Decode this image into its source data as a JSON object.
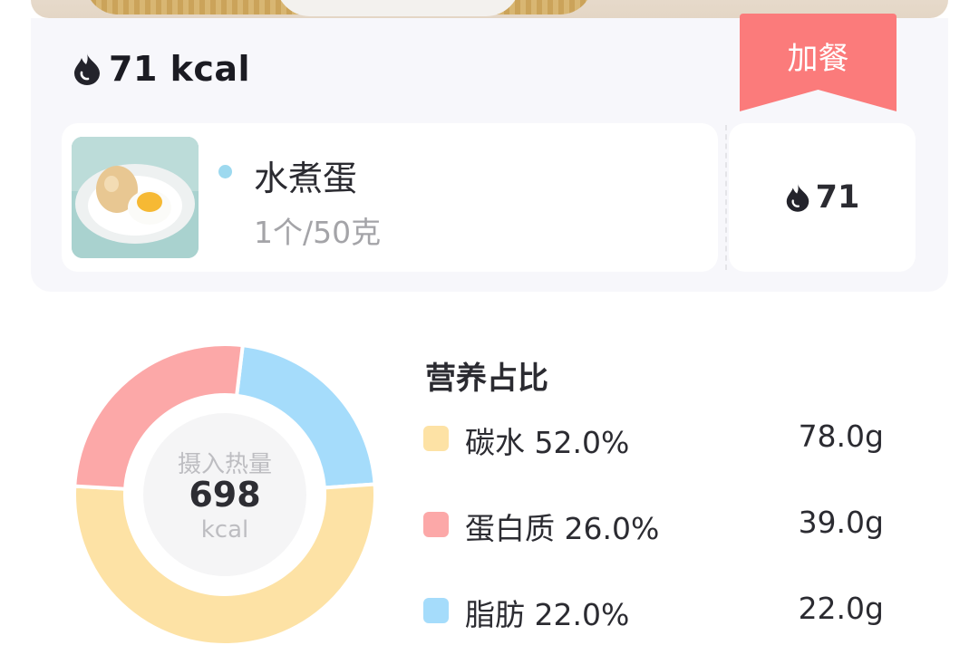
{
  "meal": {
    "total_kcal": "71 kcal",
    "tag_label": "加餐",
    "items": [
      {
        "name": "水煮蛋",
        "portion": "1个/50克",
        "kcal": "71"
      }
    ]
  },
  "summary": {
    "center_label": "摄入热量",
    "center_value": "698",
    "center_unit": "kcal",
    "title": "营养占比",
    "nutrients": [
      {
        "name": "碳水",
        "percent": "52.0%",
        "amount": "78.0g",
        "color": "#fde2a5"
      },
      {
        "name": "蛋白质",
        "percent": "26.0%",
        "amount": "39.0g",
        "color": "#fca8a8"
      },
      {
        "name": "脂肪",
        "percent": "22.0%",
        "amount": "22.0g",
        "color": "#a5dcfb"
      }
    ]
  },
  "colors": {
    "tag": "#fb7b7b",
    "flame": "#23232b"
  },
  "icons": {
    "flame": "flame-icon"
  }
}
